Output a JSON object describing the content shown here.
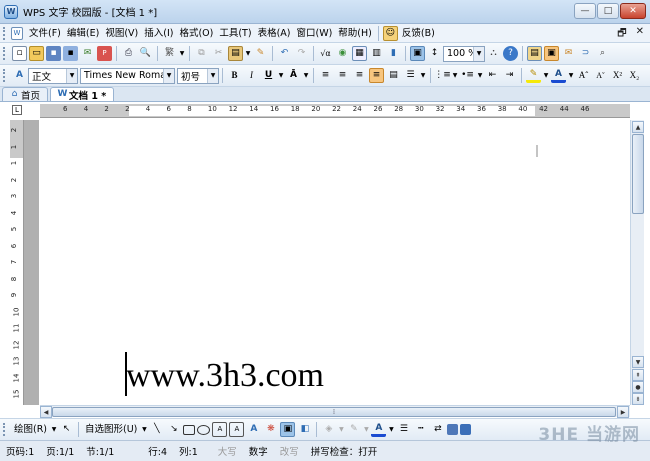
{
  "window": {
    "title": "WPS 文字 校园版 - [文档 1 *]",
    "app_icon_glyph": "W",
    "minimize": "—",
    "maximize": "□",
    "close": "✕"
  },
  "menu": {
    "items": [
      "文件(F)",
      "编辑(E)",
      "视图(V)",
      "插入(I)",
      "格式(O)",
      "工具(T)",
      "表格(A)",
      "窗口(W)",
      "帮助(H)"
    ],
    "feedback": "反馈(B)",
    "mdi_restore": "🗗",
    "mdi_close": "✕"
  },
  "toolbar": {
    "zoom": "100 %"
  },
  "format_bar": {
    "style": "正文",
    "font": "Times New Roman",
    "size": "初号",
    "bold": "B",
    "italic": "I",
    "underline": "U"
  },
  "tabs": [
    {
      "label": "首页"
    },
    {
      "label": "文档 1 *"
    }
  ],
  "ruler": {
    "h_ticks": [
      "6",
      "4",
      "2",
      "2",
      "4",
      "6",
      "8",
      "10",
      "12",
      "14",
      "16",
      "18",
      "20",
      "22",
      "24",
      "26",
      "28",
      "30",
      "32",
      "34",
      "36",
      "38",
      "40",
      "42",
      "44",
      "46"
    ],
    "v_ticks": [
      "2",
      "1",
      "1",
      "2",
      "3",
      "4",
      "5",
      "6",
      "7",
      "8",
      "9",
      "10",
      "11",
      "12",
      "13",
      "14",
      "15"
    ]
  },
  "document": {
    "text": "www.3h3.com"
  },
  "drawbar": {
    "draw_label": "绘图(R)",
    "autoshape_label": "自选图形(U)"
  },
  "status": {
    "page_code": "页码:1",
    "page": "页:1/1",
    "section": "节:1/1",
    "row": "行:4",
    "col": "列:1",
    "caps": "大写",
    "num": "数字",
    "overwrite": "改写",
    "spell": "拼写检查：打开"
  },
  "watermark": "3HE 当游网",
  "colors": {
    "accent": "#2e6db4",
    "title_bg": "#c9dcf0",
    "highlight": "#f7c57e"
  }
}
